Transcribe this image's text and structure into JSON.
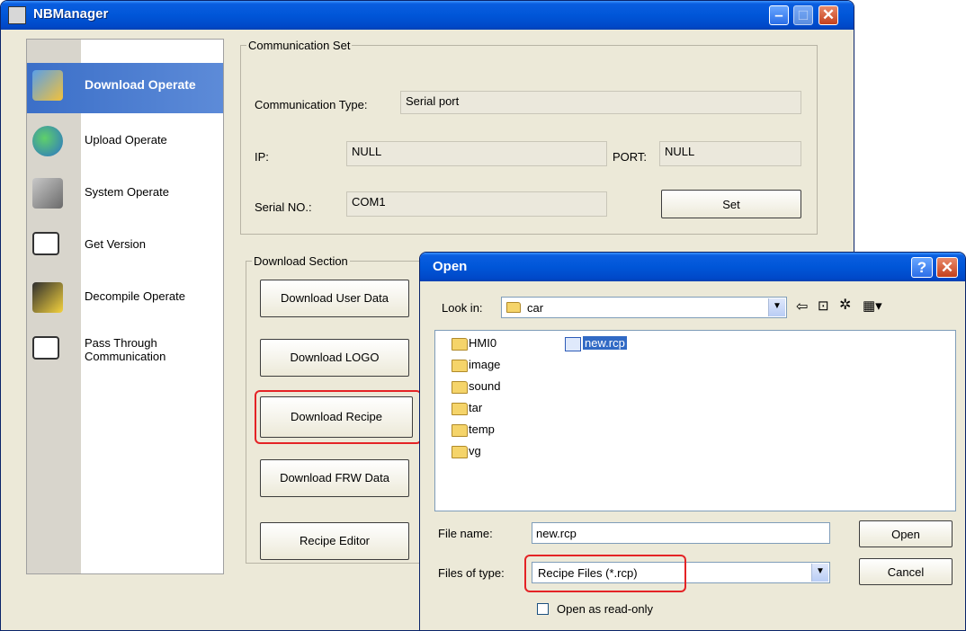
{
  "main": {
    "title": "NBManager",
    "nav": [
      {
        "label": "Download Operate",
        "icon": "download-operate-icon",
        "selected": true
      },
      {
        "label": "Upload Operate",
        "icon": "upload-operate-icon"
      },
      {
        "label": "System Operate",
        "icon": "system-operate-icon"
      },
      {
        "label": "Get Version",
        "icon": "get-version-icon"
      },
      {
        "label": "Decompile Operate",
        "icon": "decompile-operate-icon"
      },
      {
        "label": "Pass Through",
        "label2": "Communication",
        "icon": "pass-through-icon"
      }
    ],
    "comm": {
      "legend": "Communication Set",
      "type_label": "Communication Type:",
      "type_value": "Serial port",
      "ip_label": "IP:",
      "ip_value": "NULL",
      "port_label": "PORT:",
      "port_value": "NULL",
      "serial_label": "Serial NO.:",
      "serial_value": "COM1",
      "set_button": "Set"
    },
    "download": {
      "legend": "Download Section",
      "buttons": [
        "Download User Data",
        "Download LOGO",
        "Download Recipe",
        "Download FRW Data",
        "Recipe Editor"
      ]
    }
  },
  "dialog": {
    "title": "Open",
    "help_button": "?",
    "lookin_label": "Look in:",
    "lookin_value": "car",
    "folders": [
      "HMI0",
      "image",
      "sound",
      "tar",
      "temp",
      "vg"
    ],
    "files": [
      "new.rcp"
    ],
    "filename_label": "File name:",
    "filename_value": "new.rcp",
    "filetype_label": "Files of type:",
    "filetype_value": "Recipe Files (*.rcp)",
    "open_button": "Open",
    "cancel_button": "Cancel",
    "readonly_label": "Open as read-only"
  },
  "colors": {
    "highlight": "#e42326",
    "titlebar": "#0056d8",
    "selected_nav": "#3b6fc8"
  }
}
